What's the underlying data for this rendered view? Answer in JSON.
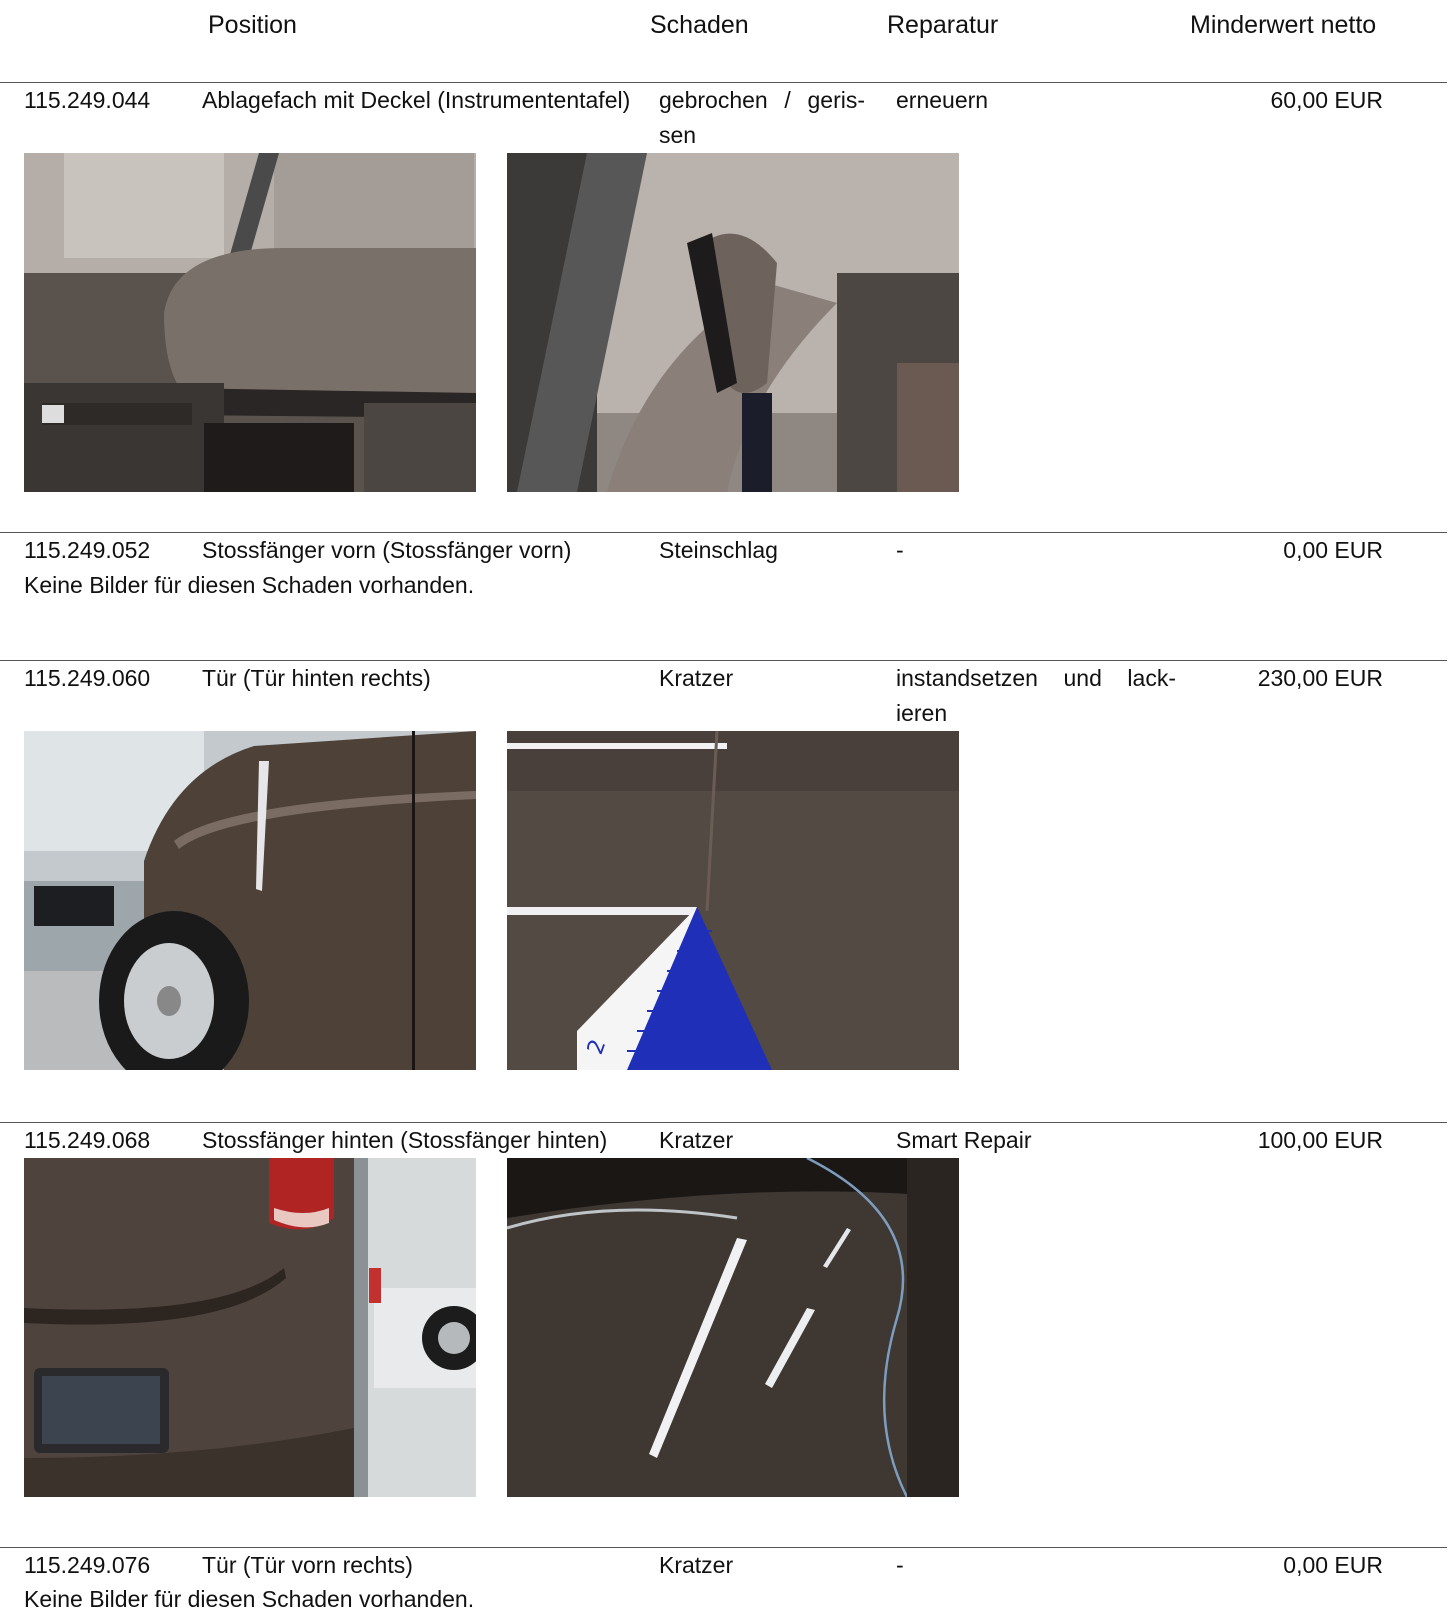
{
  "header": {
    "position": "Position",
    "schaden": "Schaden",
    "reparatur": "Reparatur",
    "minderwert": "Minderwert netto"
  },
  "rows": [
    {
      "nr": "115.249.044",
      "position": "Ablagefach mit Deckel (Instrumententafel)",
      "schaden_line1": "gebrochen / geris-",
      "schaden_line2": "sen",
      "reparatur": "erneuern",
      "minderwert": "60,00 EUR",
      "photos": [
        "armrest-photo",
        "armrest-hinge-photo"
      ]
    },
    {
      "nr": "115.249.052",
      "position": "Stossfänger vorn (Stossfänger vorn)",
      "schaden": "Steinschlag",
      "reparatur": "-",
      "minderwert": "0,00 EUR",
      "note": "Keine Bilder für diesen Schaden vorhanden."
    },
    {
      "nr": "115.249.060",
      "position": "Tür (Tür hinten rechts)",
      "schaden": "Kratzer",
      "reparatur_line1": "instandsetzen und lack-",
      "reparatur_line2": "ieren",
      "minderwert": "230,00 EUR",
      "photos": [
        "rear-door-photo",
        "scratch-closeup-ruler-photo"
      ],
      "ruler_digit": "2"
    },
    {
      "nr": "115.249.068",
      "position": "Stossfänger hinten (Stossfänger hinten)",
      "schaden": "Kratzer",
      "reparatur": "Smart Repair",
      "minderwert": "100,00 EUR",
      "photos": [
        "rear-bumper-photo",
        "rear-bumper-closeup-photo"
      ]
    },
    {
      "nr": "115.249.076",
      "position": "Tür (Tür vorn rechts)",
      "schaden": "Kratzer",
      "reparatur": "-",
      "minderwert": "0,00 EUR",
      "note": "Keine Bilder für diesen Schaden vorhanden."
    }
  ],
  "colors": {
    "car_paint": "#4e4238",
    "seat_fabric": "#6f6660",
    "rule": "#555555",
    "ruler_blue": "#1f2fb8"
  }
}
